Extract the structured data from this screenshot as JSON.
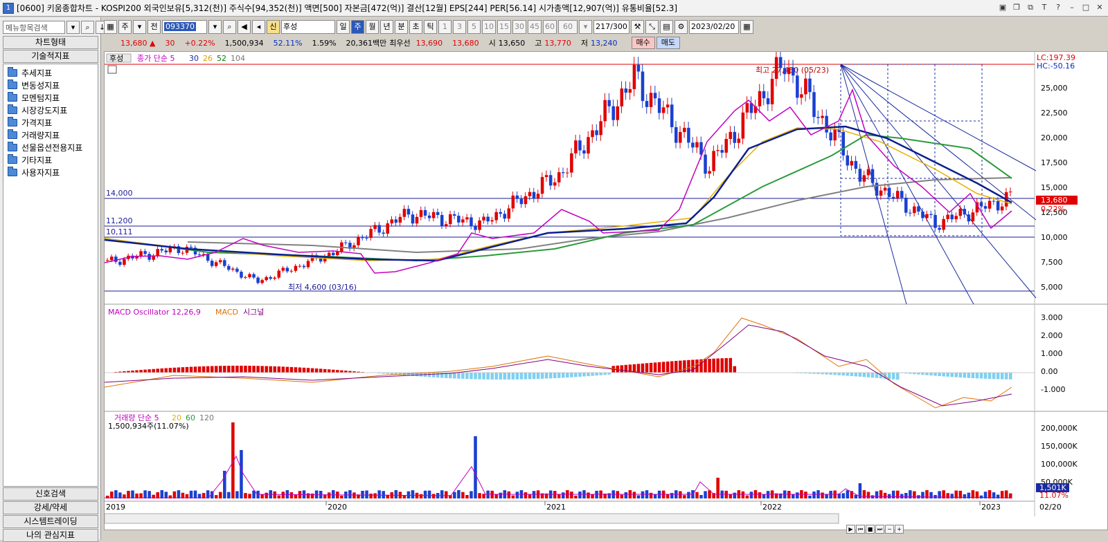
{
  "window": {
    "title": "[0600] 키움종합차트 - KOSPI200 외국인보유[5,312(천)] 주식수[94,352(천)] 액면[500] 자본금[472(억)] 결산[12월] EPS[244] PER[56.14] 시가총액[12,907(억)] 유통비율[52.3]",
    "app_icon": "1"
  },
  "left": {
    "search_placeholder": "메뉴항목검색",
    "chart_type": "차트형태",
    "tech_indicator": "기술적지표",
    "tree": [
      "추세지표",
      "변동성지표",
      "모멘텀지표",
      "시장강도지표",
      "가격지표",
      "거래량지표",
      "선물옵션전용지표",
      "기타지표",
      "사용자지표"
    ],
    "bottom": [
      "신호검색",
      "강세/약세",
      "시스템트레이딩",
      "나의 관심지표"
    ]
  },
  "toolbar": {
    "period_week": "주",
    "ji": "전",
    "code": "093370",
    "name": "후성",
    "tabs": [
      "일",
      "주",
      "월",
      "년",
      "분",
      "초",
      "틱"
    ],
    "nums": [
      "1",
      "3",
      "5",
      "10",
      "15",
      "30",
      "45",
      "60"
    ],
    "unit": "60",
    "count": "217/300",
    "date": "2023/02/20"
  },
  "quote": {
    "price": "13,680",
    "arrow": "▲",
    "change": "30",
    "rate": "+0.22%",
    "volume": "1,500,934",
    "vol_ratio": "52.11%",
    "turnover": "1.59%",
    "amount": "20,361백만",
    "best_ask_label": "최우선",
    "best_ask": "13,690",
    "best_bid": "13,680",
    "open_label": "시",
    "open": "13,650",
    "high_label": "고",
    "high": "13,770",
    "low_label": "저",
    "low": "13,240",
    "buy": "매수",
    "sell": "매도"
  },
  "price_panel": {
    "legend_name": "후성",
    "legend": "종가 단순 5",
    "ma": [
      "30",
      "26",
      "52",
      "104"
    ],
    "lc": "LC:197.39",
    "hc": "HC:-50.16",
    "hi_label": "최고 27,450 (05/23)",
    "lo_label": "최저 4,600 (03/16)",
    "levels": [
      "14,000",
      "11,200",
      "10,111"
    ],
    "last": "13,680",
    "last_rate": "0.22%",
    "yticks": [
      "25,000",
      "22,500",
      "20,000",
      "17,500",
      "15,000",
      "12,500",
      "10,000",
      "7,500",
      "5,000"
    ]
  },
  "macd_panel": {
    "legend": "MACD Oscillator 12,26,9",
    "l2": "MACD",
    "l3": "시그널",
    "yticks": [
      "3.000",
      "2.000",
      "1.000",
      "0.00",
      "-1.000"
    ]
  },
  "volume_panel": {
    "legend": "거래량 단순 5",
    "ma": [
      "20",
      "60",
      "120"
    ],
    "sub": "1,500,934주(11.07%)",
    "yticks": [
      "200,000K",
      "150,000K",
      "100,000K",
      "50,000K"
    ],
    "last": "1,501K",
    "last_rate": "11.07%"
  },
  "xaxis": {
    "years": [
      "2019",
      "2020",
      "2021",
      "2022",
      "2023"
    ],
    "end": "02/20"
  },
  "chart_data": {
    "type": "line",
    "title": "후성",
    "x": [
      "2019",
      "2020",
      "2021",
      "2022",
      "2023"
    ],
    "series": [
      {
        "name": "종가",
        "values": [
          7000,
          8500,
          5000,
          8000,
          12000,
          11000,
          16000,
          26000,
          17000,
          27450,
          16000,
          11000,
          13680
        ]
      }
    ],
    "ylim": [
      4000,
      27500
    ]
  }
}
